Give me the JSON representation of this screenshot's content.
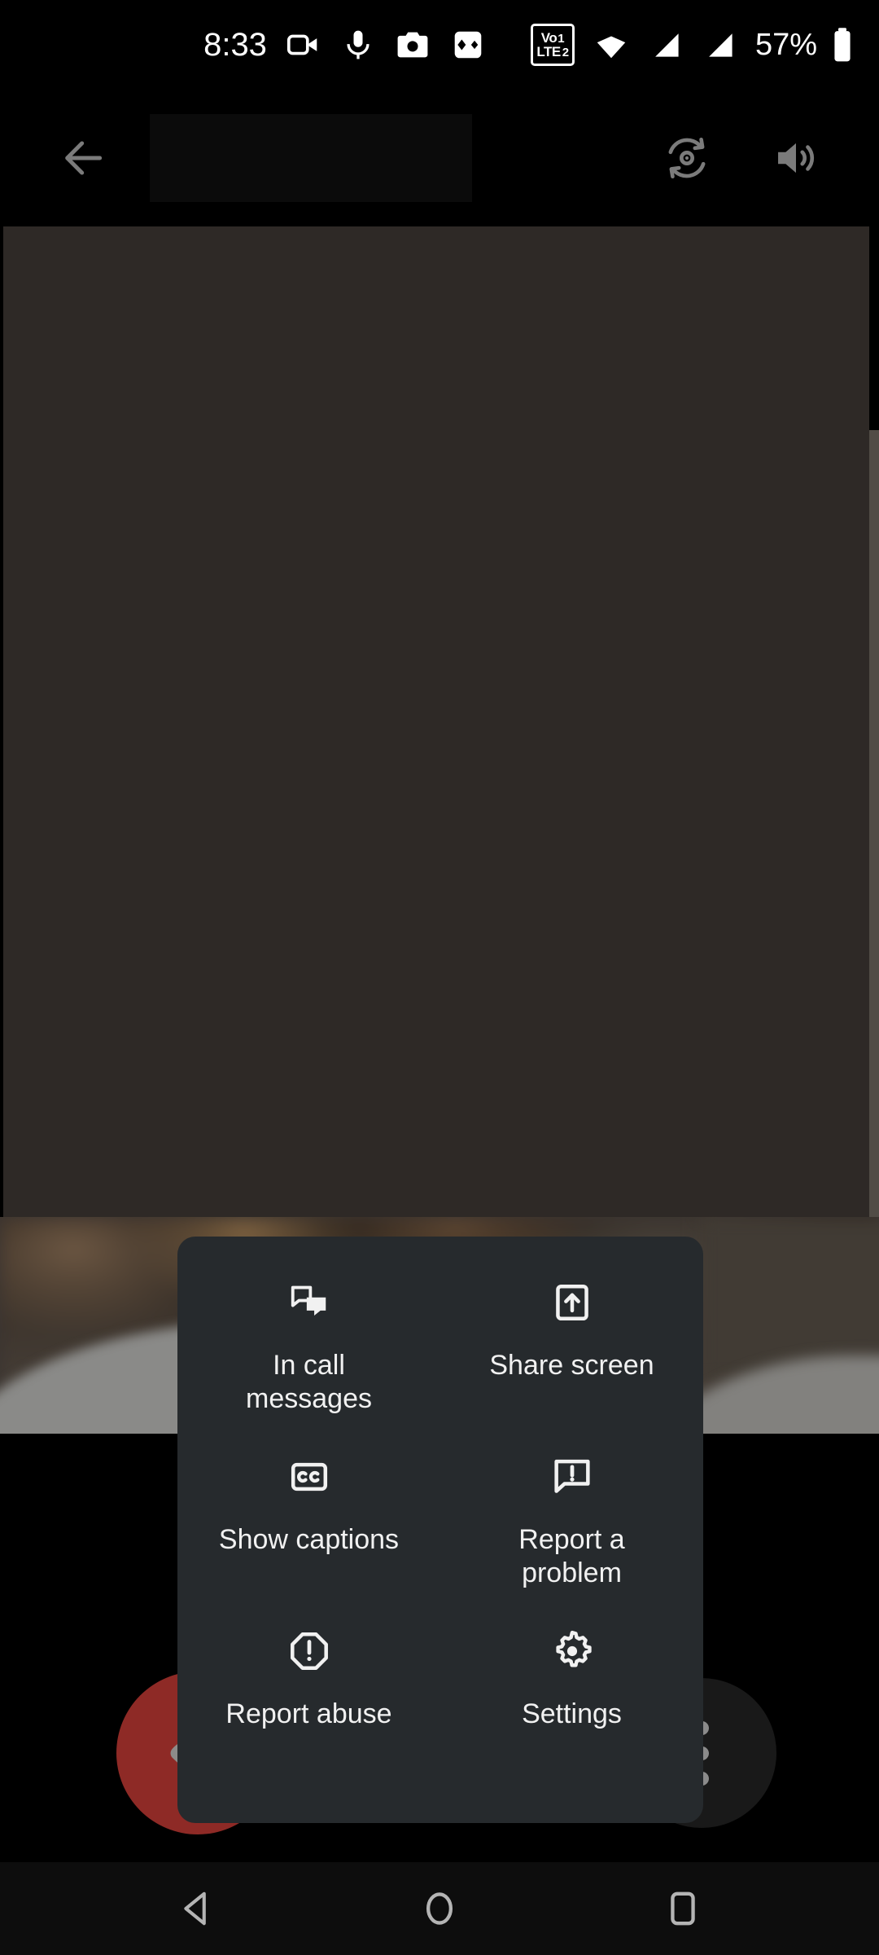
{
  "status_bar": {
    "time": "8:33",
    "battery_percent": "57%",
    "icons": [
      {
        "name": "video-camera-icon"
      },
      {
        "name": "microphone-icon"
      },
      {
        "name": "camera-icon"
      },
      {
        "name": "dual-diamond-icon"
      }
    ],
    "network": {
      "volte_label_top": "Vo",
      "volte_label_bottom": "LTE",
      "sim1": "1",
      "sim2": "2",
      "wifi_icon": "wifi-icon",
      "signal1_icon": "cellular-signal-1-icon",
      "signal2_icon": "cellular-signal-2-icon",
      "battery_icon": "battery-icon"
    }
  },
  "top_bar": {
    "back_icon": "arrow-back-icon",
    "title": "",
    "switch_camera_icon": "switch-camera-icon",
    "speaker_icon": "speaker-volume-icon"
  },
  "call": {
    "end_call_icon": "end-call-icon",
    "more_options_icon": "more-vertical-icon"
  },
  "overflow_menu": {
    "items": [
      {
        "icon": "chat-messages-icon",
        "label": "In call messages"
      },
      {
        "icon": "share-screen-icon",
        "label": "Share screen"
      },
      {
        "icon": "closed-captions-icon",
        "label": "Show captions"
      },
      {
        "icon": "report-problem-icon",
        "label": "Report a problem"
      },
      {
        "icon": "report-abuse-icon",
        "label": "Report abuse"
      },
      {
        "icon": "settings-gear-icon",
        "label": "Settings"
      }
    ]
  },
  "nav_bar": {
    "back": "nav-back-icon",
    "home": "nav-home-icon",
    "recents": "nav-recents-icon"
  },
  "colors": {
    "menu_background": "#262a2d",
    "end_call": "#8e2a26",
    "more_button": "#191919",
    "video_background": "#2e2926",
    "text": "#f1f1f1"
  }
}
